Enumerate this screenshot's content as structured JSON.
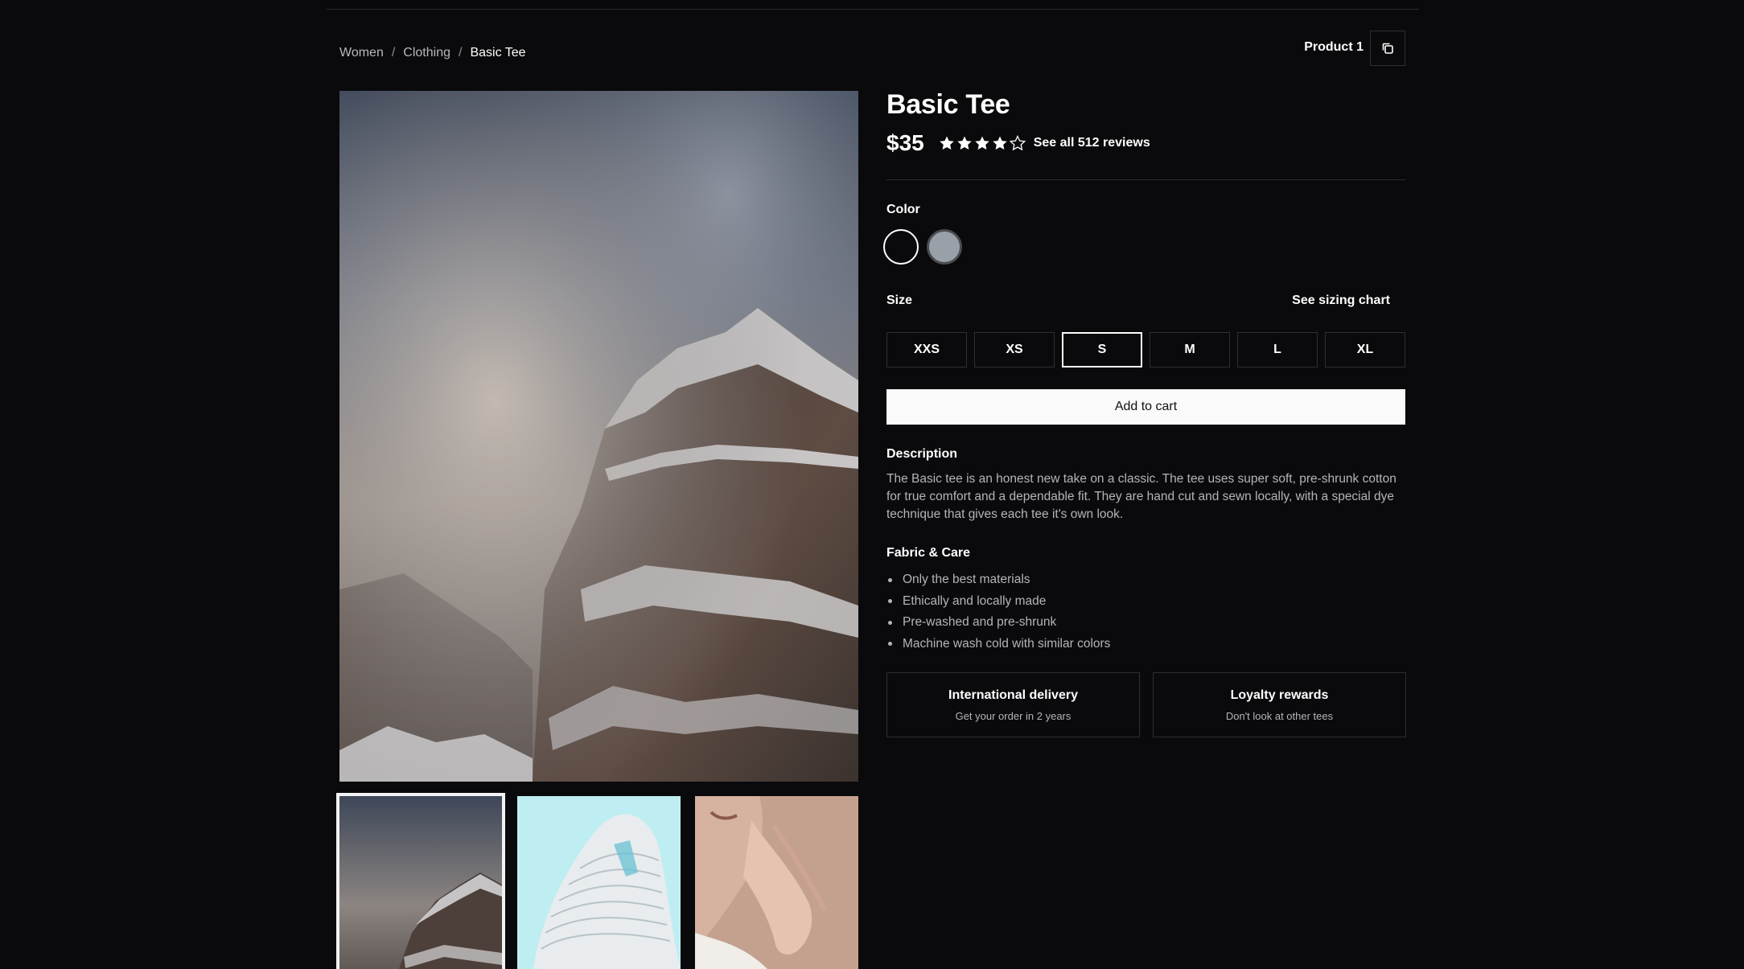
{
  "breadcrumb": {
    "items": [
      "Women",
      "Clothing"
    ],
    "separator": "/",
    "current": "Basic Tee"
  },
  "header": {
    "product_label": "Product 1",
    "copy_icon": "copy-icon"
  },
  "product": {
    "title": "Basic Tee",
    "price": "$35",
    "rating": 4,
    "rating_max": 5,
    "reviews_link": "See all 512 reviews"
  },
  "color": {
    "label": "Color",
    "options": [
      "#0a0a0c",
      "#9aa0a8"
    ],
    "selected": 0
  },
  "size": {
    "label": "Size",
    "chart_link": "See sizing chart",
    "options": [
      "XXS",
      "XS",
      "S",
      "M",
      "L",
      "XL"
    ],
    "selected": "S"
  },
  "cart": {
    "label": "Add to cart"
  },
  "description": {
    "label": "Description",
    "text": "The Basic tee is an honest new take on a classic. The tee uses super soft, pre-shrunk cotton for true comfort and a dependable fit. They are hand cut and sewn locally, with a special dye technique that gives each tee it's own look."
  },
  "care": {
    "label": "Fabric & Care",
    "items": [
      "Only the best materials",
      "Ethically and locally made",
      "Pre-washed and pre-shrunk",
      "Machine wash cold with similar colors"
    ]
  },
  "perks": [
    {
      "title": "International delivery",
      "subtitle": "Get your order in 2 years"
    },
    {
      "title": "Loyalty rewards",
      "subtitle": "Don't look at other tees"
    }
  ],
  "colors": {
    "background": "#0a0a0c",
    "border": "#2e2e33",
    "muted_text": "#b4b4ba",
    "button_bg": "#fafafa"
  }
}
